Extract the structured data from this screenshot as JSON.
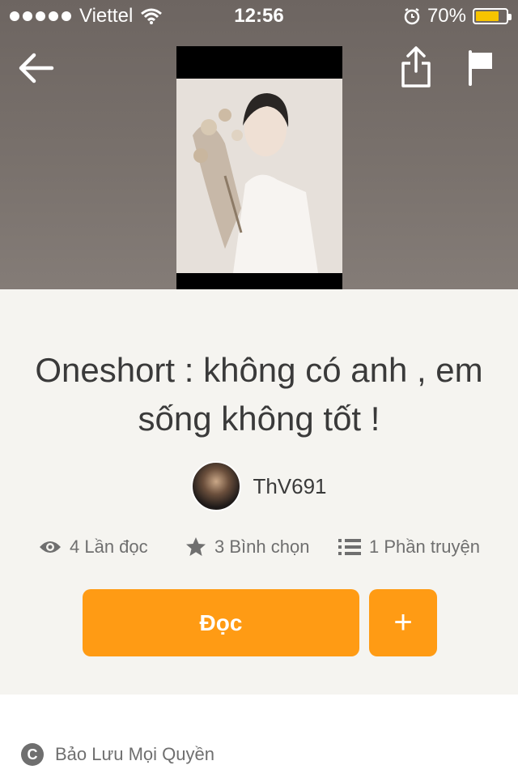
{
  "status_bar": {
    "carrier": "Viettel",
    "time": "12:56",
    "battery": "70%",
    "battery_level": 0.7
  },
  "story": {
    "title": "Oneshort : không có anh , em sống không tốt !",
    "author": "ThV691"
  },
  "stats": {
    "reads": "4 Lần đọc",
    "votes": "3 Bình chọn",
    "parts": "1 Phần truyện"
  },
  "actions": {
    "read_label": "Đọc",
    "add_label": "+"
  },
  "footer": {
    "copyright": "Bảo Lưu Mọi Quyền"
  },
  "colors": {
    "accent": "#ff9b14",
    "battery": "#f7c400",
    "background": "#f5f4f0"
  }
}
